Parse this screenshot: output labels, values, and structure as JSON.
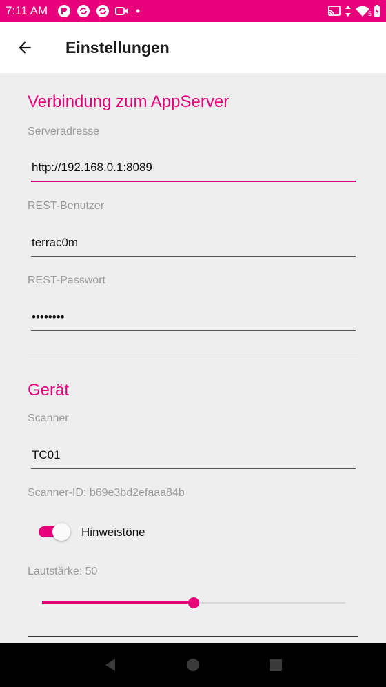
{
  "status_bar": {
    "time": "7:11 AM",
    "battery_level": "5",
    "icons_left": [
      "notification-icon",
      "sync-icon",
      "sync-icon",
      "video-icon",
      "dot-icon"
    ],
    "icons_right": [
      "cast-icon",
      "data-arrows-icon",
      "wifi-icon",
      "battery-icon"
    ]
  },
  "app_bar": {
    "title": "Einstellungen"
  },
  "sections": {
    "connection": {
      "title": "Verbindung zum AppServer",
      "server_label": "Serveradresse",
      "server_value": "http://192.168.0.1:8089",
      "user_label": "REST-Benutzer",
      "user_value": "terrac0m",
      "password_label": "REST-Passwort",
      "password_value": "••••••••"
    },
    "device": {
      "title": "Gerät",
      "scanner_label": "Scanner",
      "scanner_value": "TC01",
      "scanner_id": "Scanner-ID: b69e3bd2efaaa84b",
      "sounds_label": "Hinweistöne",
      "sounds_enabled": true,
      "volume_label": "Lautstärke: 50",
      "volume_percent": 50
    }
  },
  "colors": {
    "accent": "#e6007a",
    "background": "#eeeeee"
  }
}
